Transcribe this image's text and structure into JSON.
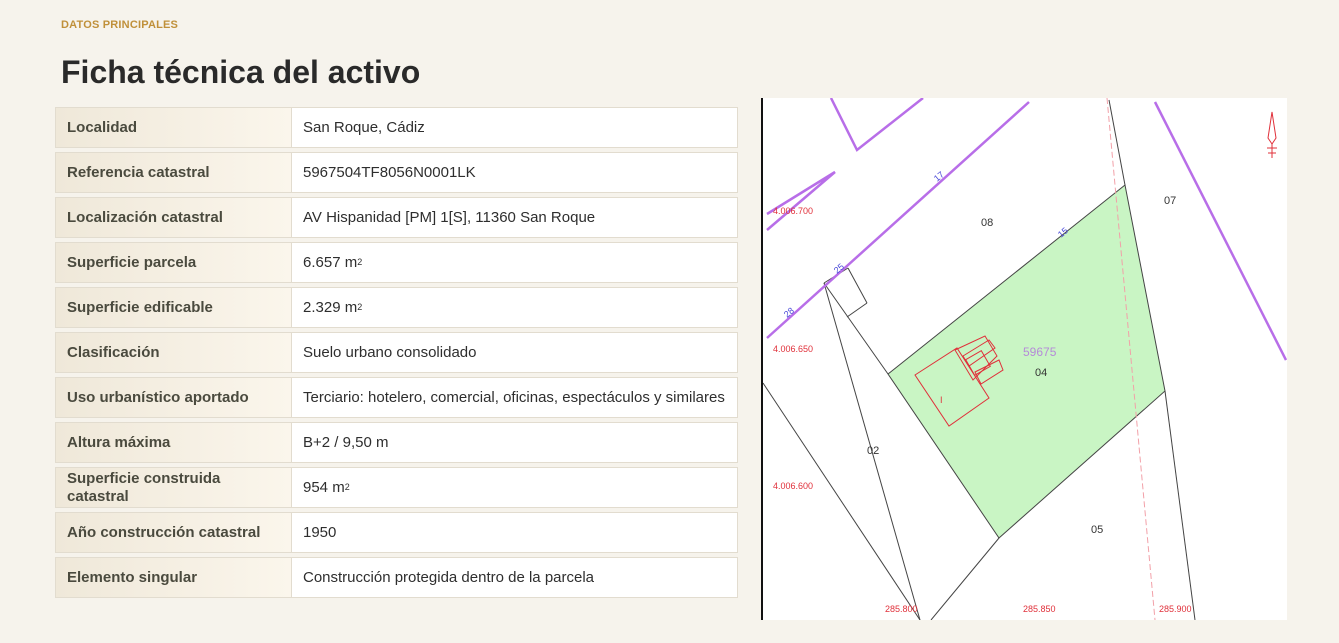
{
  "header": {
    "eyebrow": "DATOS PRINCIPALES",
    "title": "Ficha técnica del activo"
  },
  "rows": [
    {
      "label": "Localidad",
      "value": "San Roque, Cádiz",
      "sup": ""
    },
    {
      "label": "Referencia catastral",
      "value": "5967504TF8056N0001LK",
      "sup": ""
    },
    {
      "label": "Localización catastral",
      "value": "AV Hispanidad [PM] 1[S], 11360 San Roque",
      "sup": ""
    },
    {
      "label": "Superficie parcela",
      "value": "6.657 m",
      "sup": "2"
    },
    {
      "label": "Superficie edificable",
      "value": "2.329 m",
      "sup": "2"
    },
    {
      "label": "Clasificación",
      "value": "Suelo urbano consolidado",
      "sup": ""
    },
    {
      "label": "Uso urbanístico aportado",
      "value": "Terciario: hotelero, comercial, oficinas, espectáculos y similares",
      "sup": ""
    },
    {
      "label": "Altura máxima",
      "value": "B+2 / 9,50 m",
      "sup": ""
    },
    {
      "label": "Superficie construida catastral",
      "value": "954 m",
      "sup": "2"
    },
    {
      "label": "Año construcción catastral",
      "value": "1950",
      "sup": ""
    },
    {
      "label": "Elemento singular",
      "value": "Construcción protegida dentro de la parcela",
      "sup": ""
    }
  ],
  "map": {
    "colors": {
      "parcel_fill": "#c9f5c4",
      "boundary": "#b86ee8",
      "coord": "#e0303a",
      "line": "#444444"
    },
    "parcel_labels": {
      "p08": "08",
      "p07": "07",
      "p04": "04",
      "p02": "02",
      "p05": "05",
      "ref": "59675"
    },
    "street_numbers": {
      "n17": "17",
      "n15": "15",
      "n25": "25",
      "n28": "28"
    },
    "coords_y": {
      "y1": "4.006.700",
      "y2": "4.006.650",
      "y3": "4.006.600"
    },
    "coords_x": {
      "x1": "285.800",
      "x2": "285.850",
      "x3": "285.900"
    },
    "building_label": "I",
    "north_icon": "north-arrow-icon"
  }
}
